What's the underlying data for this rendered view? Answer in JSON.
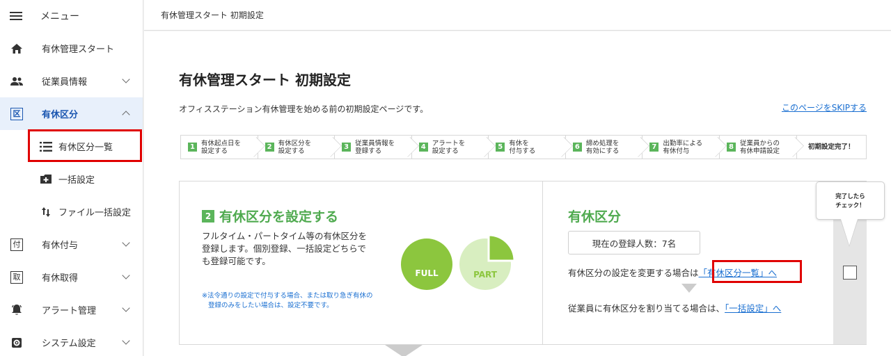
{
  "sidebar": {
    "menu_label": "メニュー",
    "items": [
      {
        "label": "有休管理スタート",
        "icon": "home-icon"
      },
      {
        "label": "従業員情報",
        "icon": "people-icon"
      },
      {
        "label": "有休区分",
        "icon": "ku-box-icon",
        "icon_char": "区"
      },
      {
        "label": "有休付与",
        "icon": "fu-box-icon",
        "icon_char": "付"
      },
      {
        "label": "有休取得",
        "icon": "shu-box-icon",
        "icon_char": "取"
      },
      {
        "label": "アラート管理",
        "icon": "bell-icon"
      },
      {
        "label": "システム設定",
        "icon": "gear-icon"
      }
    ],
    "sub_items": [
      {
        "label": "有休区分一覧",
        "icon": "list-icon"
      },
      {
        "label": "一括設定",
        "icon": "add-box-icon"
      },
      {
        "label": "ファイル一括設定",
        "icon": "sort-arrows-icon"
      }
    ]
  },
  "topbar": {
    "title": "有休管理スタート 初期設定"
  },
  "main": {
    "title": "有休管理スタート 初期設定",
    "description": "オフィスステーション有休管理を始める前の初期設定ページです。",
    "skip_link": "このページをSKIPする",
    "steps": [
      {
        "num": "1",
        "line1": "有休起点日を",
        "line2": "設定する"
      },
      {
        "num": "2",
        "line1": "有休区分を",
        "line2": "設定する"
      },
      {
        "num": "3",
        "line1": "従業員情報を",
        "line2": "登録する"
      },
      {
        "num": "4",
        "line1": "アラートを",
        "line2": "設定する"
      },
      {
        "num": "5",
        "line1": "有休を",
        "line2": "付与する"
      },
      {
        "num": "6",
        "line1": "締め処理を",
        "line2": "有効にする"
      },
      {
        "num": "7",
        "line1": "出勤率による",
        "line2": "有休付与"
      },
      {
        "num": "8",
        "line1": "従業員からの",
        "line2": "有休申請設定"
      },
      {
        "num": "",
        "line1": "初期設定完了！",
        "line2": ""
      }
    ],
    "card": {
      "step_num": "2",
      "heading": "有休区分を設定する",
      "lead": "フルタイム・パートタイム等の有休区分を登録します。個別登録、一括設定どちらでも登録可能です。",
      "note": "※法令通りの設定で付与する場合、または取り急ぎ有休の登録のみをしたい場合は、設定不要です。",
      "full_label": "FULL",
      "part_label": "PART",
      "right_heading": "有休区分",
      "count_text": "現在の登録人数：7名",
      "change_text": "有休区分の設定を変更する場合は",
      "change_link": "「有休区分一覧」へ",
      "assign_text": "従業員に有休区分を割り当てる場合は、",
      "assign_link": "「一括設定」へ",
      "check_bubble_line1": "完了したら",
      "check_bubble_line2": "チェック！"
    }
  },
  "colors": {
    "green": "#5bb55b",
    "link": "#1a6fd1",
    "highlight": "#e00000",
    "active_bg": "#e8f0fb"
  }
}
